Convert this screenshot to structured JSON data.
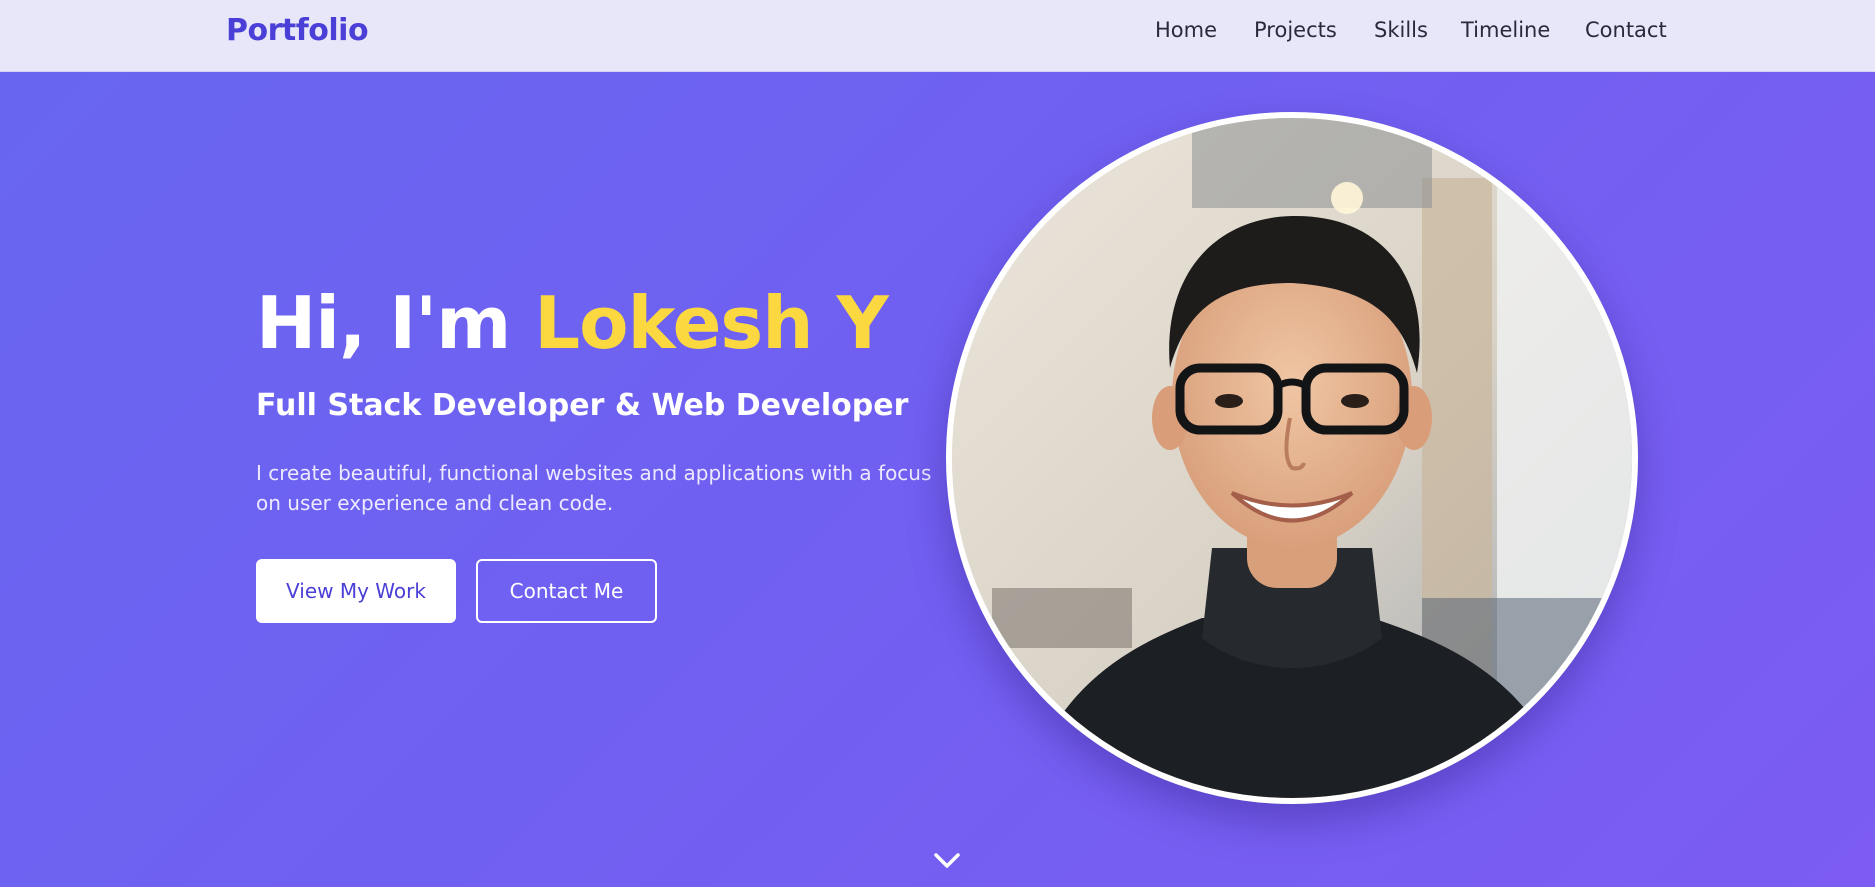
{
  "nav": {
    "brand": "Portfolio",
    "links": [
      {
        "label": "Home"
      },
      {
        "label": "Projects"
      },
      {
        "label": "Skills"
      },
      {
        "label": "Timeline"
      },
      {
        "label": "Contact"
      }
    ]
  },
  "hero": {
    "greeting_prefix": "Hi, I'm ",
    "name": "Lokesh Y",
    "subtitle": "Full Stack Developer & Web Developer",
    "description": "I create beautiful, functional websites and applications with a focus on user experience and clean code.",
    "primary_button": "View My Work",
    "secondary_button": "Contact Me"
  },
  "icons": {
    "scroll": "chevron-down-icon"
  },
  "colors": {
    "brand": "#4a3fd6",
    "hero_start": "#6866f1",
    "hero_end": "#7c5cf2",
    "highlight": "#fbd83f",
    "nav_bg": "#e8e7fa"
  }
}
